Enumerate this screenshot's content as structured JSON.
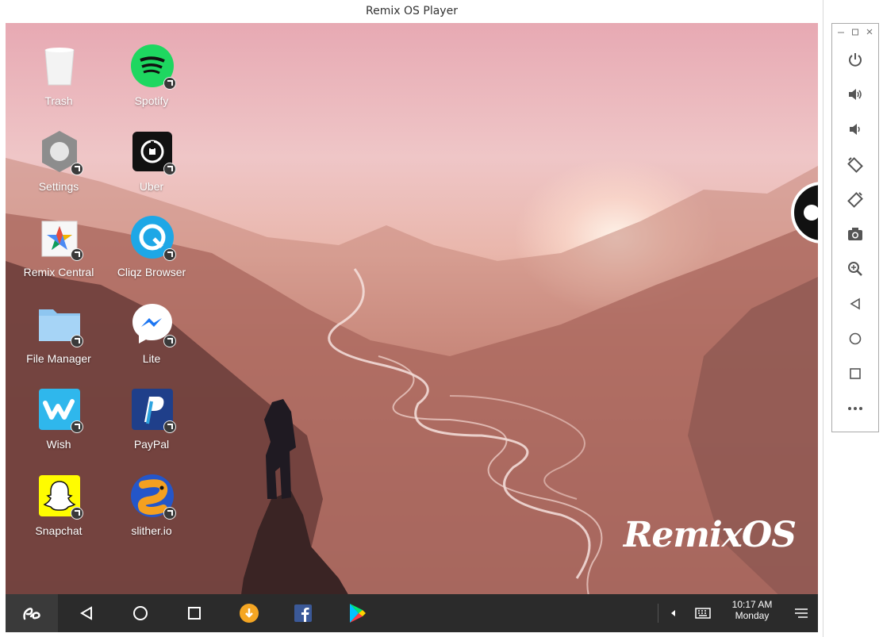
{
  "window": {
    "title": "Remix OS Player"
  },
  "desktop": {
    "icons": [
      {
        "label": "Trash",
        "icon": "trash-icon"
      },
      {
        "label": "Spotify",
        "icon": "spotify-icon"
      },
      {
        "label": "Settings",
        "icon": "settings-icon"
      },
      {
        "label": "Uber",
        "icon": "uber-icon"
      },
      {
        "label": "Remix Central",
        "icon": "remix-central-icon"
      },
      {
        "label": "Cliqz Browser",
        "icon": "cliqz-browser-icon"
      },
      {
        "label": "File Manager",
        "icon": "folder-icon"
      },
      {
        "label": "Lite",
        "icon": "messenger-lite-icon"
      },
      {
        "label": "Wish",
        "icon": "wish-icon"
      },
      {
        "label": "PayPal",
        "icon": "paypal-icon"
      },
      {
        "label": "Snapchat",
        "icon": "snapchat-icon"
      },
      {
        "label": "slither.io",
        "icon": "slither-icon"
      }
    ],
    "brand_text": "RemixOS"
  },
  "taskbar": {
    "clock_time": "10:17 AM",
    "clock_day": "Monday"
  },
  "colors": {
    "taskbar": "#2b2b2b",
    "spotify": "#1ed760",
    "cliqz": "#1ea7e6",
    "wish": "#2fb7ec",
    "snapchat": "#fffc00",
    "paypal": "#1f3f8a"
  }
}
